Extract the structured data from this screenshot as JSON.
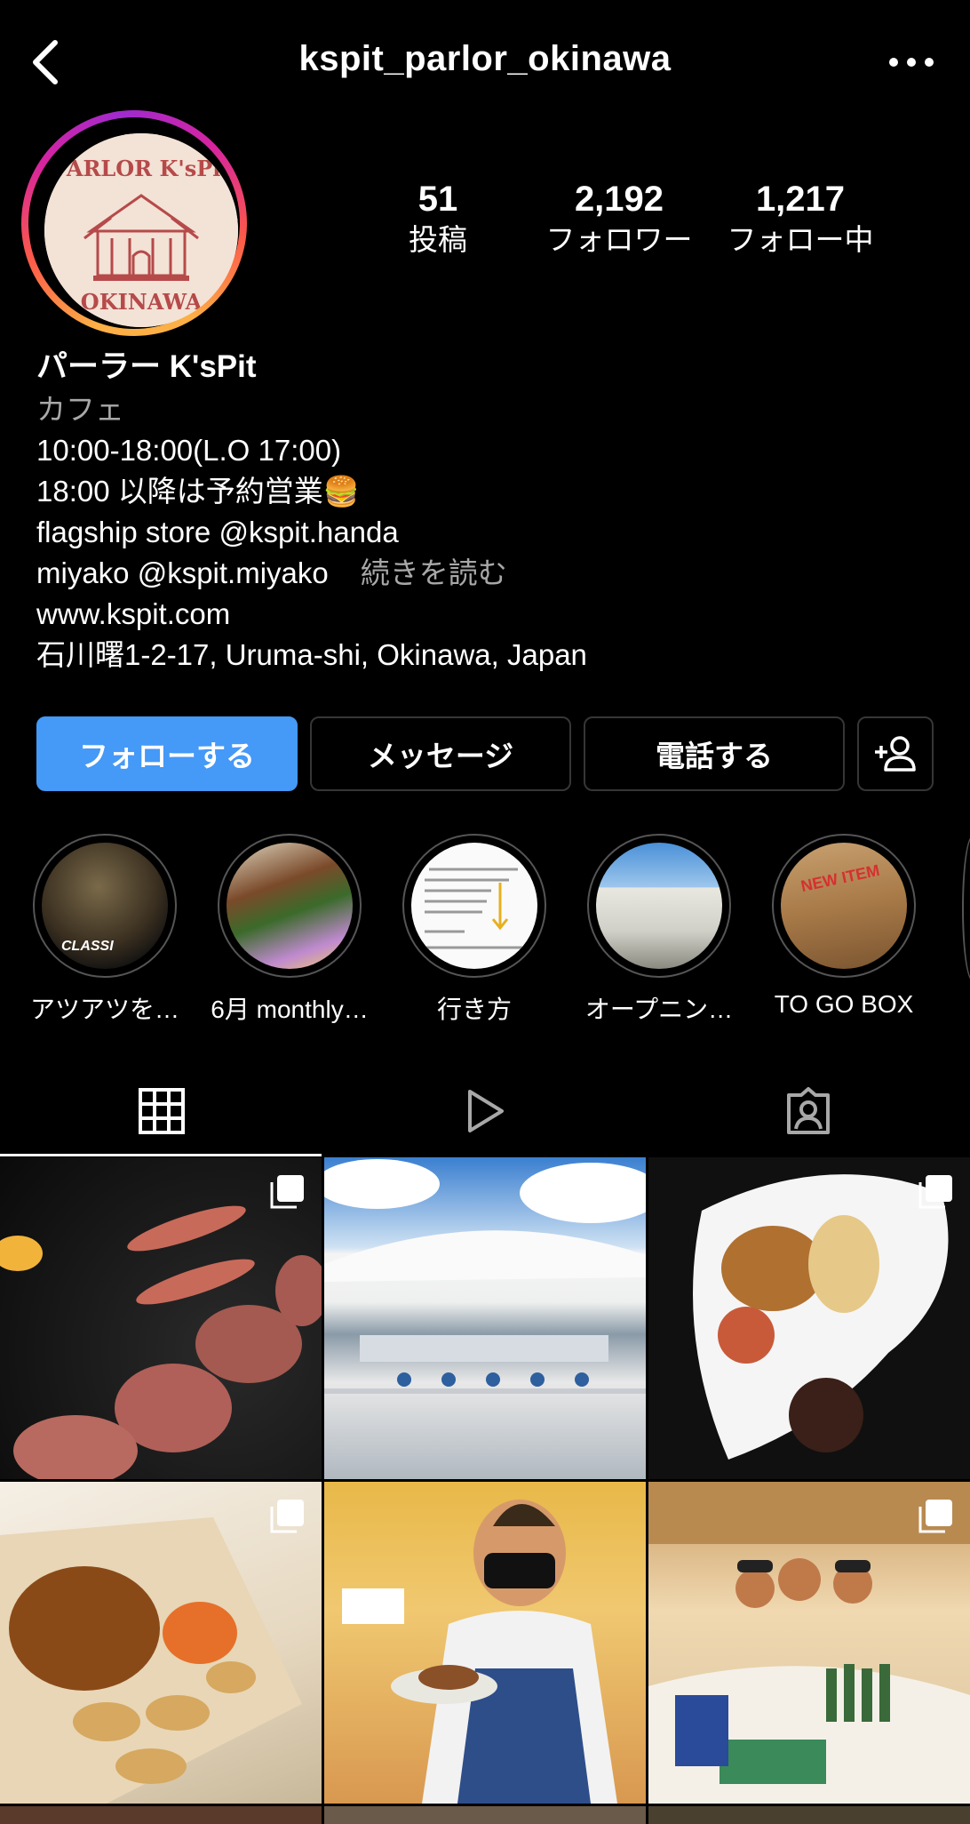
{
  "header": {
    "username": "kspit_parlor_okinawa"
  },
  "avatar": {
    "logo_top": "PARLOR K'sPit",
    "logo_bottom": "OKINAWA"
  },
  "stats": [
    {
      "value": "51",
      "label": "投稿"
    },
    {
      "value": "2,192",
      "label": "フォロワー"
    },
    {
      "value": "1,217",
      "label": "フォロー中"
    }
  ],
  "bio": {
    "name": "パーラー K'sPit",
    "category": "カフェ",
    "line1": "10:00-18:00(L.O 17:00)",
    "line2": "18:00 以降は予約営業🍔",
    "line3": "flagship store @kspit.handa",
    "line4": "miyako @kspit.miyako",
    "more": "続きを読む",
    "website": "www.kspit.com",
    "address": "石川曙1-2-17, Uruma-shi, Okinawa, Japan"
  },
  "buttons": {
    "follow": "フォローする",
    "message": "メッセージ",
    "call": "電話する"
  },
  "highlights": [
    {
      "label": "アツアツを…",
      "overlay": "CLASSI"
    },
    {
      "label": "6月 monthly…",
      "overlay": ""
    },
    {
      "label": "行き方",
      "overlay": ""
    },
    {
      "label": "オープニン…",
      "overlay": ""
    },
    {
      "label": "TO GO BOX",
      "overlay": "NEW ITEM"
    }
  ],
  "tabs": [
    "grid-tab",
    "reels-tab",
    "tagged-tab"
  ],
  "colors": {
    "follow_button": "#4599f7",
    "background": "#000000",
    "secondary_text": "#a8a8a8"
  }
}
